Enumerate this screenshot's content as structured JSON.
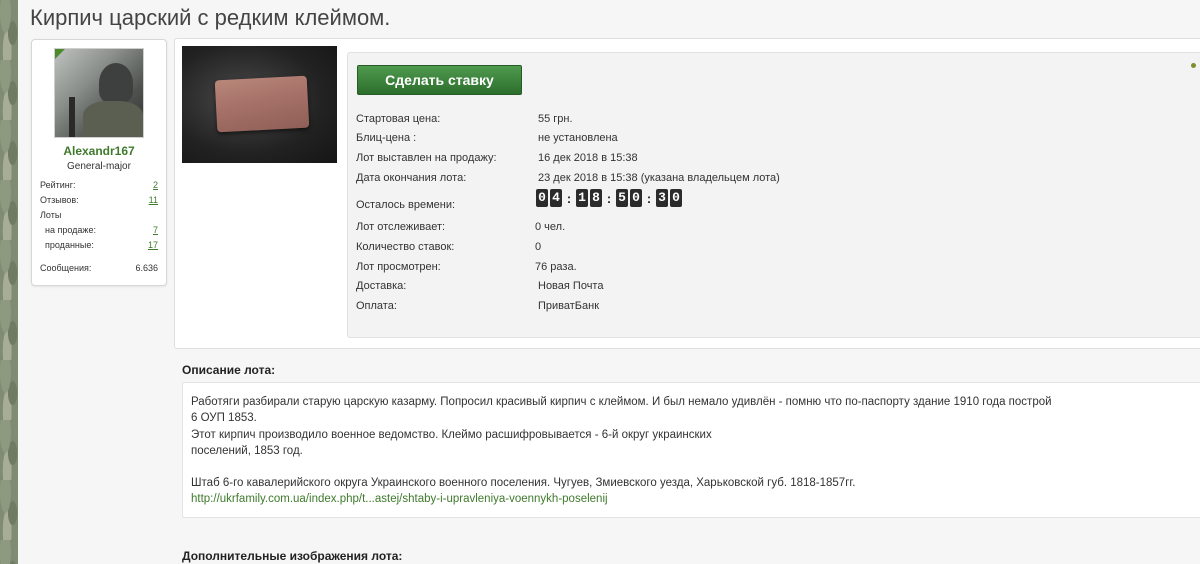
{
  "page": {
    "title": "Кирпич царский с редким клеймом."
  },
  "user": {
    "name": "Alexandr167",
    "rank": "General-major",
    "stats": [
      {
        "label": "Рейтинг:",
        "value": "2"
      },
      {
        "label": "Отзывов:",
        "value": "11"
      },
      {
        "label": "Лоты",
        "value": ""
      },
      {
        "label": "на продаже:",
        "value": "7"
      },
      {
        "label": "проданные:",
        "value": "17"
      },
      {
        "label": "Сообщения:",
        "value": "6.636"
      }
    ]
  },
  "lot": {
    "bid_button": "Сделать ставку",
    "fields": [
      {
        "label": "Стартовая цена:",
        "value": "55 грн."
      },
      {
        "label": "Блиц-цена :",
        "value": "не установлена"
      },
      {
        "label": "Лот выставлен на продажу:",
        "value": "16 дек 2018 в 15:38"
      },
      {
        "label": "Дата окончания лота:",
        "value": "23 дек 2018 в 15:38 (указана владельцем лота)"
      },
      {
        "label": "Осталось времени:",
        "value": ""
      },
      {
        "label": "Лот отслеживает:",
        "value": "0 чел."
      },
      {
        "label": "Количество ставок:",
        "value": "0"
      },
      {
        "label": "Лот просмотрен:",
        "value": "76 раза."
      },
      {
        "label": "Доставка:",
        "value": "Новая Почта"
      },
      {
        "label": "Оплата:",
        "value": "ПриватБанк"
      }
    ],
    "timer": {
      "d1": "0",
      "d2": "4",
      "h1": "1",
      "h2": "8",
      "m1": "5",
      "m2": "0",
      "s1": "3",
      "s2": "0"
    }
  },
  "description": {
    "title": "Описание лота:",
    "lines": [
      "Работяги разбирали старую царскую казарму. Попросил красивый кирпич с клеймом. И был немало удивлён - помню что по-паспорту здание 1910 года построй",
      "6 ОУП 1853.",
      "Этот кирпич производило военное ведомство. Клеймо расшифровывается - 6-й округ украинских",
      "поселений, 1853 год.",
      "Штаб 6-го кавалерийского округа Украинского военного поселения. Чугуев, Змиевского уезда, Харьковской губ. 1818-1857гг."
    ],
    "link": "http://ukrfamily.com.ua/index.php/t...astej/shtaby-i-upravleniya-voennykh-poselenij"
  },
  "extra": {
    "title": "Дополнительные изображения лота:"
  }
}
